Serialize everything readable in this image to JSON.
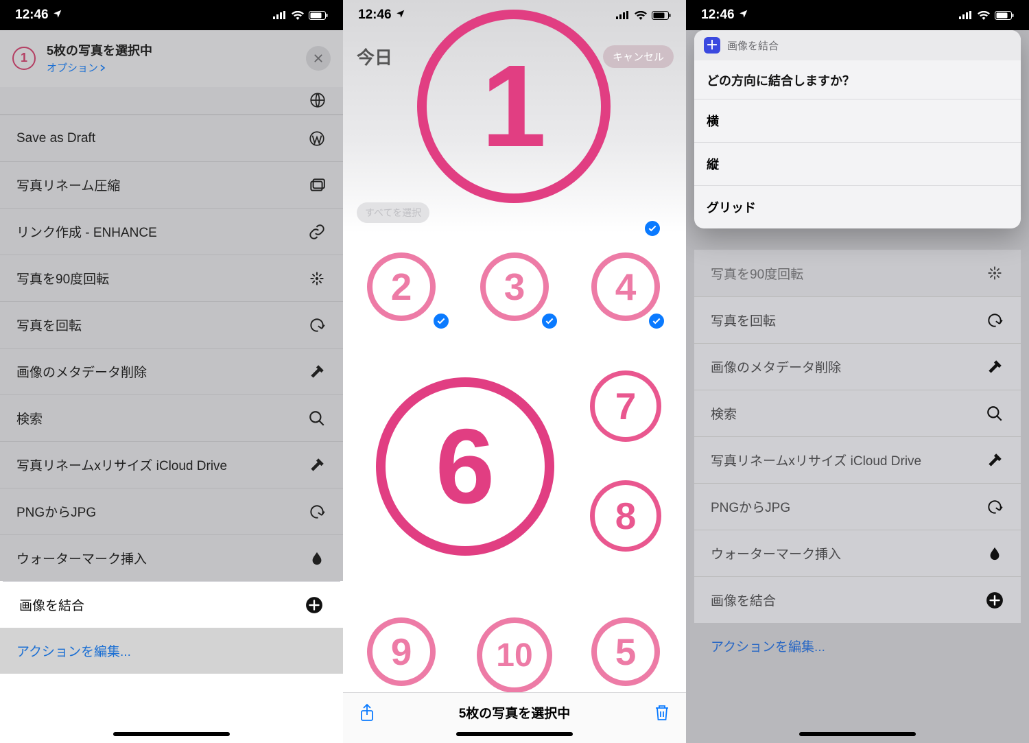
{
  "status": {
    "time": "12:46"
  },
  "s1": {
    "badge_number": "1",
    "header_title": "5枚の写真を選択中",
    "options_label": "オプション",
    "edit_actions": "アクションを編集...",
    "rows": [
      {
        "label": "Save as Draft"
      },
      {
        "label": "写真リネーム圧縮"
      },
      {
        "label": "リンク作成 - ENHANCE"
      },
      {
        "label": "写真を90度回転"
      },
      {
        "label": "写真を回転"
      },
      {
        "label": "画像のメタデータ削除"
      },
      {
        "label": "検索"
      },
      {
        "label": "写真リネームxリサイズ iCloud Drive"
      },
      {
        "label": "PNGからJPG"
      },
      {
        "label": "ウォーターマーク挿入"
      },
      {
        "label": "画像を結合"
      }
    ]
  },
  "s2": {
    "today_label": "今日",
    "cancel_label": "キャンセル",
    "select_all_label": "すべてを選択",
    "selection_status": "5枚の写真を選択中",
    "numbers": [
      "1",
      "2",
      "3",
      "4",
      "6",
      "7",
      "8",
      "9",
      "10",
      "5"
    ]
  },
  "s3": {
    "sheet_title": "画像を結合",
    "question": "どの方向に結合しますか？",
    "options": [
      "横",
      "縦",
      "グリッド"
    ],
    "bg_rows": [
      {
        "label": "写真を90度回転"
      },
      {
        "label": "写真を回転"
      },
      {
        "label": "画像のメタデータ削除"
      },
      {
        "label": "検索"
      },
      {
        "label": "写真リネームxリサイズ iCloud Drive"
      },
      {
        "label": "PNGからJPG"
      },
      {
        "label": "ウォーターマーク挿入"
      },
      {
        "label": "画像を結合"
      }
    ],
    "edit_actions": "アクションを編集..."
  }
}
